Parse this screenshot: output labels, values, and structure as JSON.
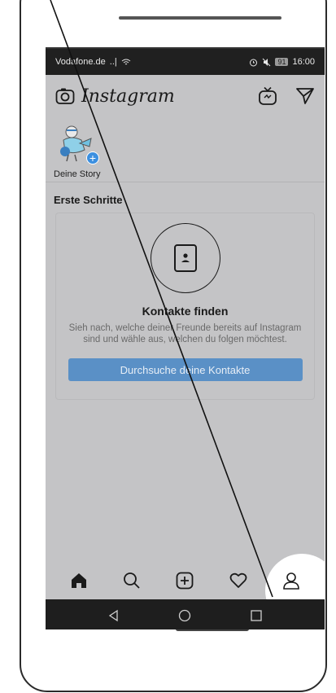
{
  "statusbar": {
    "carrier": "Vodafone.de",
    "signal": "..|",
    "battery": "91",
    "time": "16:00"
  },
  "appbar": {
    "logo": "Instagram",
    "icons": [
      "camera-icon",
      "igtv-icon",
      "direct-message-icon"
    ]
  },
  "stories": {
    "items": [
      {
        "label": "Deine Story"
      }
    ]
  },
  "main": {
    "section_title": "Erste Schritte",
    "card": {
      "title": "Kontakte finden",
      "description": "Sieh nach, welche deiner Freunde bereits auf Instagram sind und wähle aus, welchen du folgen möchtest.",
      "button_label": "Durchsuche deine Kontakte"
    }
  },
  "tabbar": {
    "items": [
      "home-icon",
      "search-icon",
      "new-post-icon",
      "activity-icon",
      "profile-icon"
    ]
  },
  "navbar": {
    "items": [
      "back-icon",
      "home-circle-icon",
      "recents-icon"
    ]
  },
  "colors": {
    "screen_bg": "#c4c4c6",
    "button_bg": "#5a90c6",
    "story_plus": "#3b8fe0"
  }
}
